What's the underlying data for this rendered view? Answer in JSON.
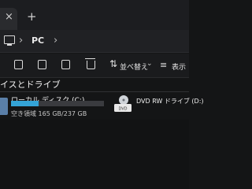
{
  "window": {
    "tab_close_glyph": "×",
    "new_tab_glyph": "+"
  },
  "address_bar": {
    "separator": "›",
    "crumb": "PC"
  },
  "toolbar": {
    "sort_label": "並べ替え",
    "view_label": "表示"
  },
  "section": {
    "title": "イスとドライブ"
  },
  "drives": {
    "local": {
      "name": "ローカル ディスク (C:)",
      "free_text": "空き領域 165 GB/237 GB",
      "used_fraction": 0.3
    },
    "dvd": {
      "name": "DVD RW ドライブ (D:)",
      "icon_label": "DVD"
    }
  },
  "colors": {
    "usage_bar": "#34a3d6",
    "background": "#141516"
  },
  "icons": [
    "close-icon",
    "plus-icon",
    "pc-icon",
    "chevron-right-icon",
    "cut-icon",
    "copy-icon",
    "paste-icon",
    "share-icon",
    "delete-icon",
    "sort-icon",
    "chevron-down-icon",
    "view-icon",
    "drive-icon",
    "dvd-icon"
  ]
}
